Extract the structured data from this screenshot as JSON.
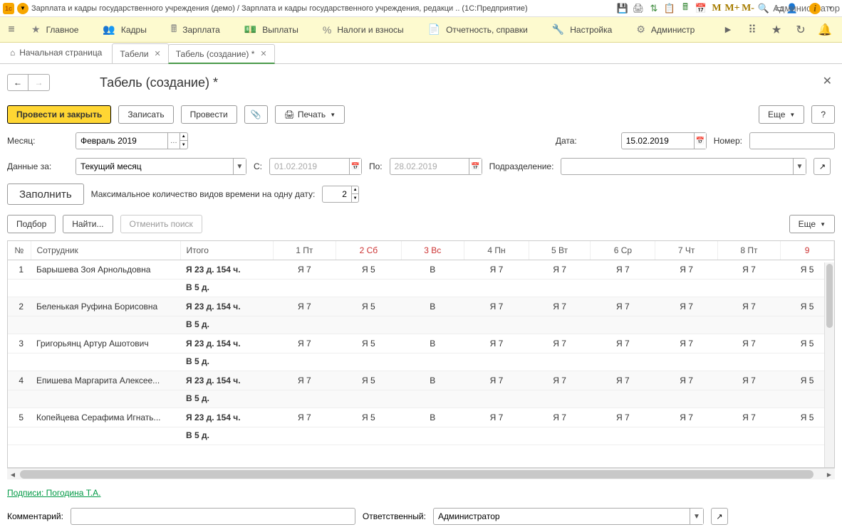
{
  "titlebar": {
    "title": "Зарплата и кадры государственного учреждения (демо) / Зарплата и кадры государственного учреждения, редакци .. (1С:Предприятие)",
    "user": "Администратор",
    "M": "M",
    "Mplus": "M+",
    "Mminus": "M-"
  },
  "menu": {
    "items": [
      "Главное",
      "Кадры",
      "Зарплата",
      "Выплаты",
      "Налоги и взносы",
      "Отчетность, справки",
      "Настройка",
      "Администр"
    ]
  },
  "tabs": {
    "home": "Начальная страница",
    "tab1": "Табели",
    "tab2": "Табель (создание) *"
  },
  "page": {
    "title": "Табель (создание) *"
  },
  "toolbar": {
    "primary": "Провести и закрыть",
    "write": "Записать",
    "post": "Провести",
    "print": "Печать",
    "more": "Еще",
    "help": "?"
  },
  "form": {
    "month_label": "Месяц:",
    "month_value": "Февраль 2019",
    "date_label": "Дата:",
    "date_value": "15.02.2019",
    "number_label": "Номер:",
    "data_for_label": "Данные за:",
    "data_for_value": "Текущий месяц",
    "from_label": "С:",
    "from_placeholder": "01.02.2019",
    "to_label": "По:",
    "to_placeholder": "28.02.2019",
    "dept_label": "Подразделение:",
    "fill": "Заполнить",
    "max_types_label": "Максимальное количество видов времени на одну дату:",
    "max_types_value": "2",
    "select": "Подбор",
    "find": "Найти...",
    "cancel_search": "Отменить поиск"
  },
  "table": {
    "columns": {
      "num": "№",
      "employee": "Сотрудник",
      "total": "Итого",
      "d1": "1 Пт",
      "d2": "2 Сб",
      "d3": "3 Вс",
      "d4": "4 Пн",
      "d5": "5 Вт",
      "d6": "6 Ср",
      "d7": "7 Чт",
      "d8": "8 Пт",
      "d9": "9"
    },
    "cell_common": {
      "ya7": "Я 7",
      "ya5": "Я 5",
      "v": "В",
      "total_main": "Я 23 д. 154 ч.",
      "total_sub": "В 5 д."
    },
    "rows": [
      {
        "num": "1",
        "name": "Барышева Зоя Арнольдовна"
      },
      {
        "num": "2",
        "name": "Беленькая Руфина Борисовна"
      },
      {
        "num": "3",
        "name": "Григорьянц Артур Ашотович"
      },
      {
        "num": "4",
        "name": "Епишева Маргарита Алексее..."
      },
      {
        "num": "5",
        "name": "Копейцева Серафима Игнать..."
      }
    ]
  },
  "footer": {
    "sig_link": "Подписи: Погодина Т.А.",
    "comment_label": "Комментарий:",
    "resp_label": "Ответственный:",
    "resp_value": "Администратор"
  }
}
